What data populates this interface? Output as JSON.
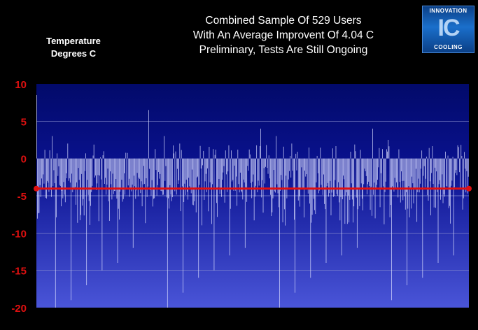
{
  "header": {
    "title_lines": [
      "Combined Sample Of 529 Users",
      "With An Average Improvent Of 4.04 C",
      "Preliminary, Tests Are Still Ongoing"
    ],
    "y_label_lines": [
      "Temperature",
      "Degrees C"
    ]
  },
  "logo": {
    "top": "INNOVATION",
    "mid": "IC",
    "bottom": "COOLING"
  },
  "colors": {
    "plot_top": "#020a6a",
    "plot_bottom": "#4a55d8",
    "bars": "#d8dcff",
    "average_line": "#e01010",
    "tick_labels": "#e01010",
    "grid": "#8a90d0"
  },
  "chart_data": {
    "type": "bar",
    "title": "Combined Sample Of 529 Users With An Average Improvent Of 4.04 C",
    "subtitle": "Preliminary, Tests Are Still Ongoing",
    "ylabel": "Temperature Degrees C",
    "n_samples": 529,
    "average": -4.04,
    "ylim": [
      -20,
      10
    ],
    "yticks": [
      10,
      5,
      0,
      -5,
      -10,
      -15,
      -20
    ],
    "grid": true,
    "notable_values": [
      -20,
      -20,
      -20,
      -19,
      -19,
      -18,
      -18,
      -17,
      -17,
      -16,
      -16,
      -16,
      -15,
      -15,
      -14,
      -14,
      -14,
      -13,
      -13,
      -13,
      -12,
      -12,
      -12,
      8.5,
      6.5,
      4,
      4,
      3,
      3,
      3,
      2.5,
      2,
      2,
      2
    ]
  }
}
